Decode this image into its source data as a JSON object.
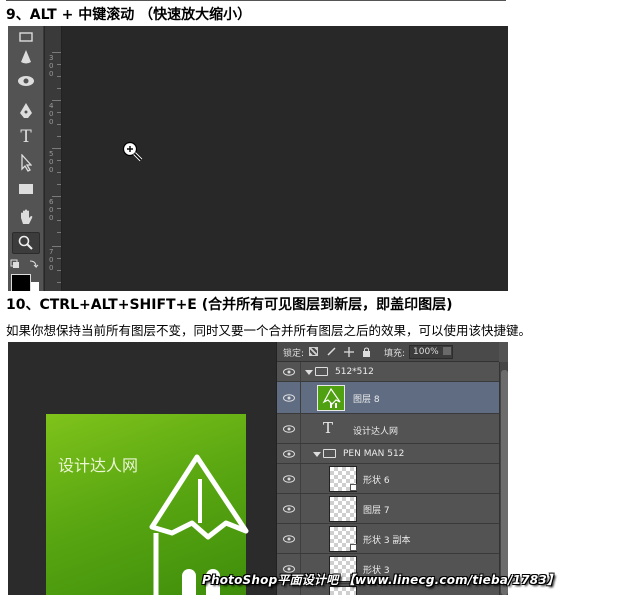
{
  "section1": {
    "heading": "9、ALT + 中键滚动 （快速放大缩小）"
  },
  "section2": {
    "heading": "10、CTRL+ALT+SHIFT+E (合并所有可见图层到新层，即盖印图层)",
    "description": "如果你想保持当前所有图层不变，同时又要一个合并所有图层之后的效果，可以使用该快捷键。"
  },
  "ruler": {
    "labels": [
      "3 0 0",
      "4 0 0",
      "5 0 0",
      "6 0 0",
      "7 0 0"
    ]
  },
  "toolbar": {
    "tools": [
      "rectangle-select-icon",
      "drop-icon",
      "eye-dodge-icon",
      "pen-icon",
      "type-icon",
      "path-select-icon",
      "shape-rect-icon",
      "hand-icon",
      "zoom-icon"
    ],
    "type_glyph": "T",
    "active_tool": "zoom-icon"
  },
  "artwork": {
    "title": "设计达人网",
    "colors": {
      "green_light": "#7fc31b",
      "green_dark": "#3d8c0a"
    }
  },
  "layers_panel": {
    "lock_label": "锁定:",
    "fill_label": "填充:",
    "fill_value": "100%",
    "type_glyph": "T",
    "layers": [
      {
        "name": "512*512",
        "kind": "group"
      },
      {
        "name": "图层 8",
        "kind": "pixel",
        "selected": true
      },
      {
        "name": "设计达人网",
        "kind": "text"
      },
      {
        "name": "PEN MAN 512",
        "kind": "group"
      },
      {
        "name": "形状 6",
        "kind": "shape"
      },
      {
        "name": "图层 7",
        "kind": "pixel"
      },
      {
        "name": "形状 3 副本",
        "kind": "shape"
      },
      {
        "name": "形状 3",
        "kind": "shape"
      }
    ]
  },
  "watermark": {
    "text": "PhotoShop平面设计吧 【www.linecg.com/tieba/1783】"
  }
}
